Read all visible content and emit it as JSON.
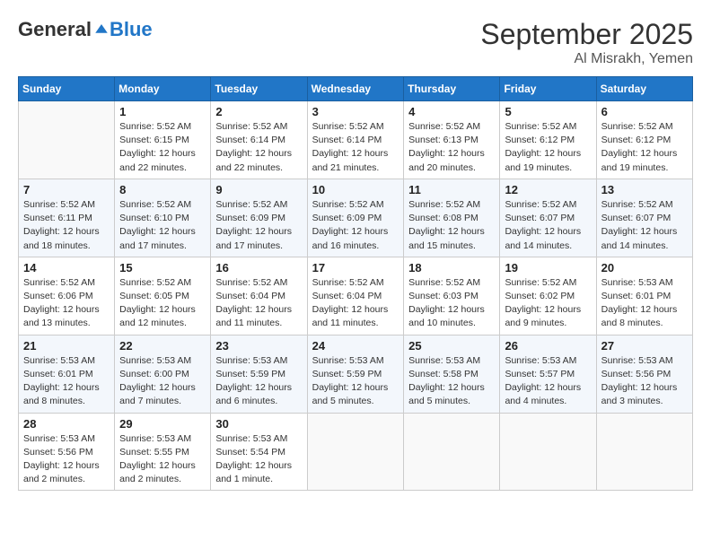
{
  "header": {
    "logo_general": "General",
    "logo_blue": "Blue",
    "month_year": "September 2025",
    "location": "Al Misrakh, Yemen"
  },
  "weekdays": [
    "Sunday",
    "Monday",
    "Tuesday",
    "Wednesday",
    "Thursday",
    "Friday",
    "Saturday"
  ],
  "weeks": [
    [
      {
        "day": "",
        "info": ""
      },
      {
        "day": "1",
        "info": "Sunrise: 5:52 AM\nSunset: 6:15 PM\nDaylight: 12 hours\nand 22 minutes."
      },
      {
        "day": "2",
        "info": "Sunrise: 5:52 AM\nSunset: 6:14 PM\nDaylight: 12 hours\nand 22 minutes."
      },
      {
        "day": "3",
        "info": "Sunrise: 5:52 AM\nSunset: 6:14 PM\nDaylight: 12 hours\nand 21 minutes."
      },
      {
        "day": "4",
        "info": "Sunrise: 5:52 AM\nSunset: 6:13 PM\nDaylight: 12 hours\nand 20 minutes."
      },
      {
        "day": "5",
        "info": "Sunrise: 5:52 AM\nSunset: 6:12 PM\nDaylight: 12 hours\nand 19 minutes."
      },
      {
        "day": "6",
        "info": "Sunrise: 5:52 AM\nSunset: 6:12 PM\nDaylight: 12 hours\nand 19 minutes."
      }
    ],
    [
      {
        "day": "7",
        "info": "Sunrise: 5:52 AM\nSunset: 6:11 PM\nDaylight: 12 hours\nand 18 minutes."
      },
      {
        "day": "8",
        "info": "Sunrise: 5:52 AM\nSunset: 6:10 PM\nDaylight: 12 hours\nand 17 minutes."
      },
      {
        "day": "9",
        "info": "Sunrise: 5:52 AM\nSunset: 6:09 PM\nDaylight: 12 hours\nand 17 minutes."
      },
      {
        "day": "10",
        "info": "Sunrise: 5:52 AM\nSunset: 6:09 PM\nDaylight: 12 hours\nand 16 minutes."
      },
      {
        "day": "11",
        "info": "Sunrise: 5:52 AM\nSunset: 6:08 PM\nDaylight: 12 hours\nand 15 minutes."
      },
      {
        "day": "12",
        "info": "Sunrise: 5:52 AM\nSunset: 6:07 PM\nDaylight: 12 hours\nand 14 minutes."
      },
      {
        "day": "13",
        "info": "Sunrise: 5:52 AM\nSunset: 6:07 PM\nDaylight: 12 hours\nand 14 minutes."
      }
    ],
    [
      {
        "day": "14",
        "info": "Sunrise: 5:52 AM\nSunset: 6:06 PM\nDaylight: 12 hours\nand 13 minutes."
      },
      {
        "day": "15",
        "info": "Sunrise: 5:52 AM\nSunset: 6:05 PM\nDaylight: 12 hours\nand 12 minutes."
      },
      {
        "day": "16",
        "info": "Sunrise: 5:52 AM\nSunset: 6:04 PM\nDaylight: 12 hours\nand 11 minutes."
      },
      {
        "day": "17",
        "info": "Sunrise: 5:52 AM\nSunset: 6:04 PM\nDaylight: 12 hours\nand 11 minutes."
      },
      {
        "day": "18",
        "info": "Sunrise: 5:52 AM\nSunset: 6:03 PM\nDaylight: 12 hours\nand 10 minutes."
      },
      {
        "day": "19",
        "info": "Sunrise: 5:52 AM\nSunset: 6:02 PM\nDaylight: 12 hours\nand 9 minutes."
      },
      {
        "day": "20",
        "info": "Sunrise: 5:53 AM\nSunset: 6:01 PM\nDaylight: 12 hours\nand 8 minutes."
      }
    ],
    [
      {
        "day": "21",
        "info": "Sunrise: 5:53 AM\nSunset: 6:01 PM\nDaylight: 12 hours\nand 8 minutes."
      },
      {
        "day": "22",
        "info": "Sunrise: 5:53 AM\nSunset: 6:00 PM\nDaylight: 12 hours\nand 7 minutes."
      },
      {
        "day": "23",
        "info": "Sunrise: 5:53 AM\nSunset: 5:59 PM\nDaylight: 12 hours\nand 6 minutes."
      },
      {
        "day": "24",
        "info": "Sunrise: 5:53 AM\nSunset: 5:59 PM\nDaylight: 12 hours\nand 5 minutes."
      },
      {
        "day": "25",
        "info": "Sunrise: 5:53 AM\nSunset: 5:58 PM\nDaylight: 12 hours\nand 5 minutes."
      },
      {
        "day": "26",
        "info": "Sunrise: 5:53 AM\nSunset: 5:57 PM\nDaylight: 12 hours\nand 4 minutes."
      },
      {
        "day": "27",
        "info": "Sunrise: 5:53 AM\nSunset: 5:56 PM\nDaylight: 12 hours\nand 3 minutes."
      }
    ],
    [
      {
        "day": "28",
        "info": "Sunrise: 5:53 AM\nSunset: 5:56 PM\nDaylight: 12 hours\nand 2 minutes."
      },
      {
        "day": "29",
        "info": "Sunrise: 5:53 AM\nSunset: 5:55 PM\nDaylight: 12 hours\nand 2 minutes."
      },
      {
        "day": "30",
        "info": "Sunrise: 5:53 AM\nSunset: 5:54 PM\nDaylight: 12 hours\nand 1 minute."
      },
      {
        "day": "",
        "info": ""
      },
      {
        "day": "",
        "info": ""
      },
      {
        "day": "",
        "info": ""
      },
      {
        "day": "",
        "info": ""
      }
    ]
  ]
}
